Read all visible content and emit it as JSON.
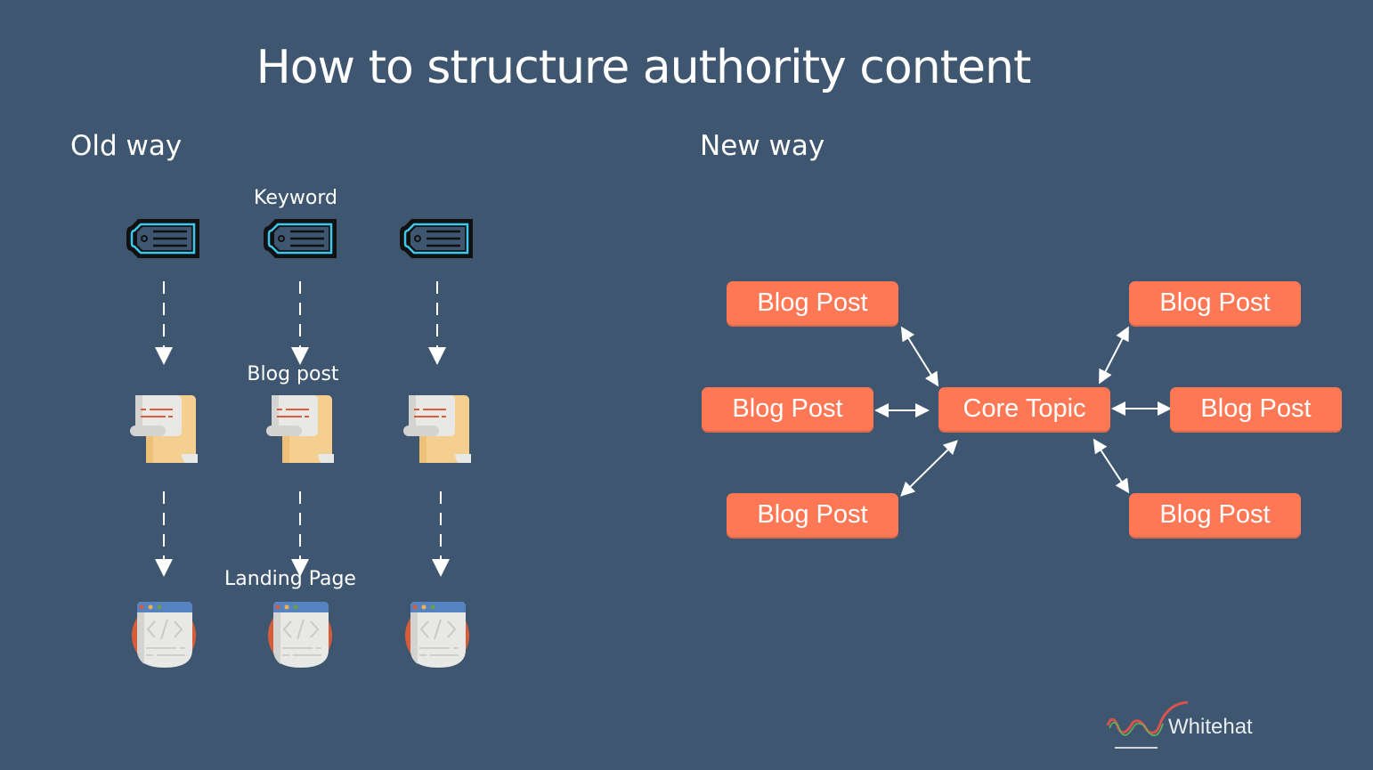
{
  "title": "How to structure authority content",
  "old_way": {
    "heading": "Old way",
    "labels": {
      "keyword": "Keyword",
      "blog_post": "Blog post",
      "landing_page": "Landing Page"
    },
    "columns": 3,
    "icons": [
      "tag-icon",
      "scroll-document-icon",
      "browser-code-icon"
    ]
  },
  "new_way": {
    "heading": "New way",
    "core": "Core Topic",
    "posts": [
      "Blog Post",
      "Blog Post",
      "Blog Post",
      "Blog Post",
      "Blog Post",
      "Blog Post"
    ]
  },
  "colors": {
    "background": "#3e566f",
    "box": "#ff7855",
    "tag_outline": "#3fc6ec"
  },
  "logo": {
    "text": "Whitehat"
  }
}
